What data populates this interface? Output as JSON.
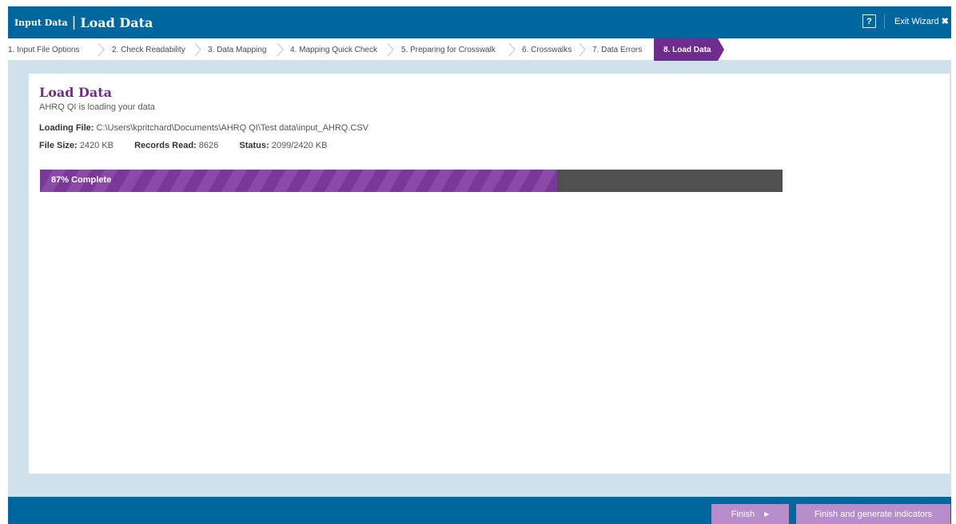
{
  "header": {
    "section": "Input Data",
    "separator": "|",
    "title": "Load Data",
    "help_label": "?",
    "exit_label": "Exit Wizard",
    "exit_icon": "✖"
  },
  "steps": [
    {
      "label": "1. Input File Options"
    },
    {
      "label": "2. Check Readability"
    },
    {
      "label": "3. Data Mapping"
    },
    {
      "label": "4. Mapping Quick Check"
    },
    {
      "label": "5. Preparing for Crosswalk"
    },
    {
      "label": "6. Crosswalks"
    },
    {
      "label": "7. Data Errors"
    },
    {
      "label": "8. Load Data",
      "active": true
    }
  ],
  "main": {
    "title": "Load Data",
    "subtitle": "AHRQ QI is loading your data",
    "loading_file_label": "Loading File:",
    "loading_file_value": "C:\\Users\\kpritchard\\Documents\\AHRQ QI\\Test data\\input_AHRQ.CSV",
    "file_size_label": "File Size:",
    "file_size_value": "2420 KB",
    "records_read_label": "Records Read:",
    "records_read_value": "8626",
    "status_label": "Status:",
    "status_value": "2099/2420 KB",
    "progress_label": "87% Complete",
    "progress_value": 0.87
  },
  "footer": {
    "finish_label": "Finish",
    "finish_arrow": "▶",
    "finish_generate_label": "Finish and generate indicators"
  },
  "colors": {
    "header_blue": "#00679e",
    "accent_purple": "#6e2c8c",
    "progress_track": "#505050",
    "button_disabled": "#b68ccb"
  }
}
